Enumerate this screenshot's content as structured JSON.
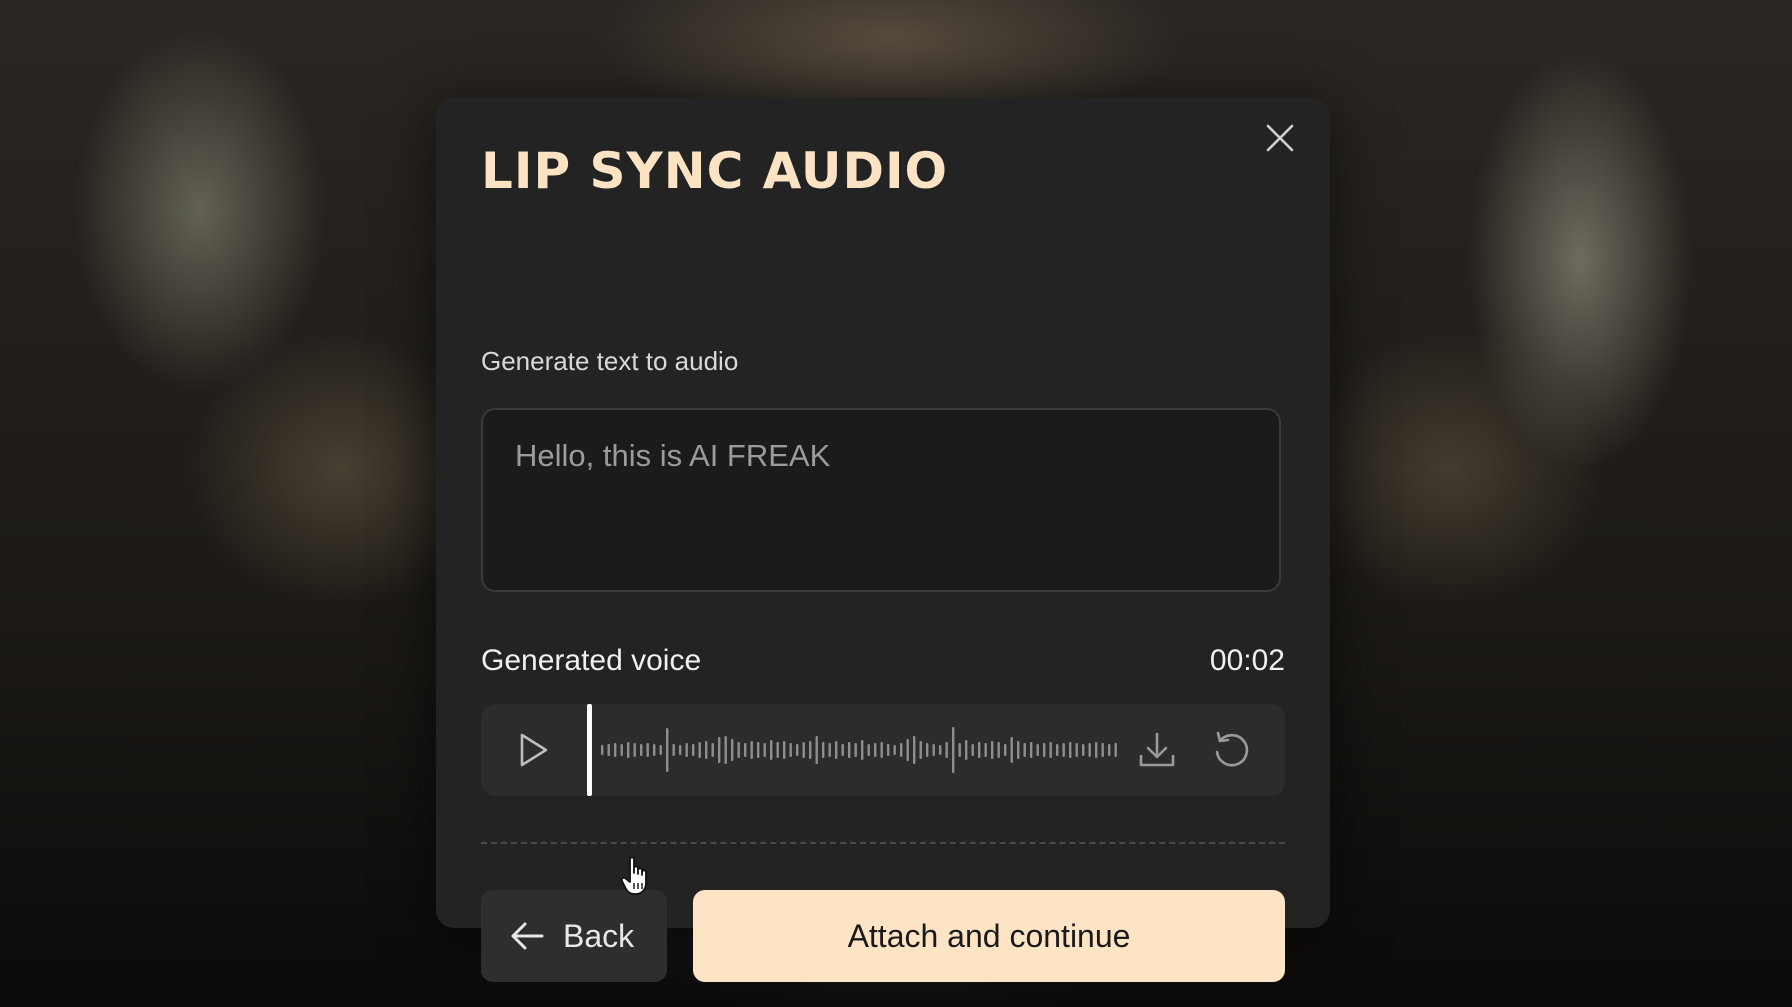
{
  "dialog": {
    "title": "LIP SYNC AUDIO",
    "subtitle": "Generate text to audio",
    "text_input_value": "Hello, this is AI FREAK",
    "voice_section": {
      "label": "Generated voice",
      "duration": "00:02",
      "playback_progress": 0
    },
    "buttons": {
      "back_label": "Back",
      "attach_label": "Attach and continue"
    },
    "icons": [
      "close-icon",
      "play-icon",
      "download-icon",
      "reload-icon",
      "arrow-left-icon",
      "hand-pointer-cursor-icon"
    ]
  },
  "colors": {
    "title": "#fbe3c4",
    "primary_button_bg": "#fde4c5",
    "modal_bg": "#232323"
  }
}
